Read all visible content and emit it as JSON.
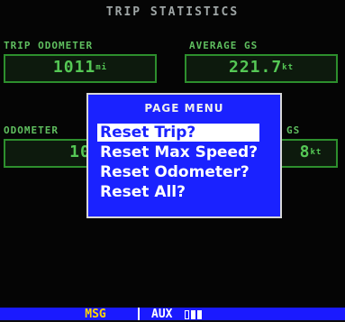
{
  "screen": {
    "title": "TRIP STATISTICS"
  },
  "fields": {
    "trip_odometer": {
      "label": "TRIP ODOMETER",
      "value": "1011",
      "unit": "mi"
    },
    "average_gs": {
      "label": "AVERAGE GS",
      "value": "221.7",
      "unit": "kt"
    },
    "odometer": {
      "label": "ODOMETER",
      "value": "10",
      "unit": ""
    },
    "max_speed": {
      "label": "GS",
      "value": "8",
      "unit": "kt"
    }
  },
  "menu": {
    "title": "PAGE MENU",
    "items": [
      "Reset Trip?",
      "Reset Max Speed?",
      "Reset Odometer?",
      "Reset All?"
    ]
  },
  "status_bar": {
    "msg_label": "MSG",
    "aux_label": "AUX"
  },
  "colors": {
    "menu_bg": "#1a22ff",
    "field_text": "#55c855",
    "msg_text": "#ffd700"
  }
}
